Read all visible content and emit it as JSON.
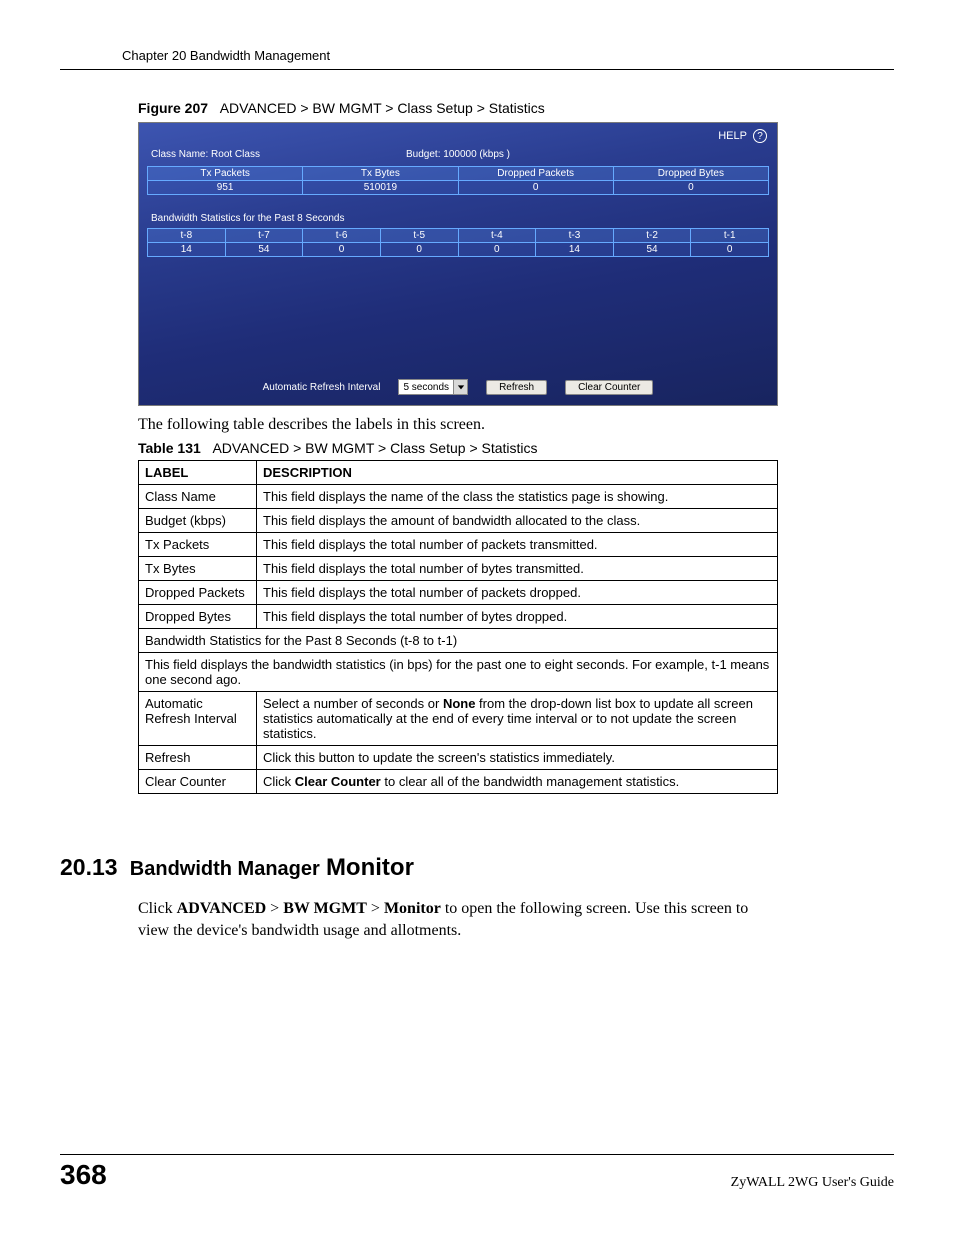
{
  "header": {
    "running_head": "Chapter 20 Bandwidth Management"
  },
  "figure": {
    "label": "Figure 207",
    "caption": "ADVANCED > BW MGMT > Class Setup > Statistics"
  },
  "screenshot": {
    "help_text": "HELP",
    "class_name_label": "Class Name:",
    "class_name_value": "Root Class",
    "budget_label": "Budget:",
    "budget_value": "100000 (kbps )",
    "stats1_headers": [
      "Tx Packets",
      "Tx Bytes",
      "Dropped Packets",
      "Dropped Bytes"
    ],
    "stats1_values": [
      "951",
      "510019",
      "0",
      "0"
    ],
    "subhead": "Bandwidth Statistics for the Past 8 Seconds",
    "stats2_headers": [
      "t-8",
      "t-7",
      "t-6",
      "t-5",
      "t-4",
      "t-3",
      "t-2",
      "t-1"
    ],
    "stats2_values": [
      "14",
      "54",
      "0",
      "0",
      "0",
      "14",
      "54",
      "0"
    ],
    "refresh_label": "Automatic Refresh Interval",
    "refresh_value": "5 seconds",
    "refresh_btn": "Refresh",
    "clear_btn": "Clear Counter"
  },
  "para_intro": "The following table describes the labels in this screen.",
  "table_caption": {
    "label": "Table 131",
    "caption": "ADVANCED > BW MGMT > Class Setup > Statistics"
  },
  "desc_table": {
    "col1": "LABEL",
    "col2": "DESCRIPTION",
    "rows": [
      {
        "label": "Class Name",
        "desc": "This field displays the name of the class the statistics page is showing."
      },
      {
        "label": "Budget (kbps)",
        "desc": "This field displays the amount of bandwidth allocated to the class."
      },
      {
        "label": "Tx Packets",
        "desc": "This field displays the total number of packets transmitted."
      },
      {
        "label": "Tx Bytes",
        "desc": "This field displays the total number of bytes transmitted."
      },
      {
        "label": "Dropped Packets",
        "desc": "This field displays the total number of packets dropped."
      },
      {
        "label": "Dropped Bytes",
        "desc": "This field displays the total number of bytes dropped."
      }
    ],
    "merged1": "Bandwidth Statistics for the Past 8 Seconds (t-8 to t-1)",
    "merged2": "This field displays the bandwidth statistics (in bps) for the past one to eight seconds. For example, t-1 means one second ago.",
    "rows2": [
      {
        "label": "Automatic Refresh Interval",
        "desc_pre": "Select a number of seconds or ",
        "desc_bold": "None",
        "desc_post": " from the drop-down list box to update all screen statistics automatically at the end of every time interval or to not update the screen statistics."
      },
      {
        "label": "Refresh",
        "desc": "Click this button to update the screen's statistics immediately."
      },
      {
        "label": "Clear Counter",
        "desc_pre": "Click ",
        "desc_bold": "Clear Counter",
        "desc_post": " to clear all of the bandwidth management statistics."
      }
    ]
  },
  "section": {
    "number": "20.13",
    "title_bold": "Bandwidth Manager",
    "title_big": "Monitor"
  },
  "body": {
    "p1_a": "Click ",
    "p1_b": "ADVANCED",
    "p1_c": " > ",
    "p1_d": "BW MGMT",
    "p1_e": " > ",
    "p1_f": "Monitor",
    "p1_g": " to open the following screen. Use this screen to view the device's bandwidth usage and allotments."
  },
  "footer": {
    "page_number": "368",
    "guide": "ZyWALL 2WG User's Guide"
  }
}
